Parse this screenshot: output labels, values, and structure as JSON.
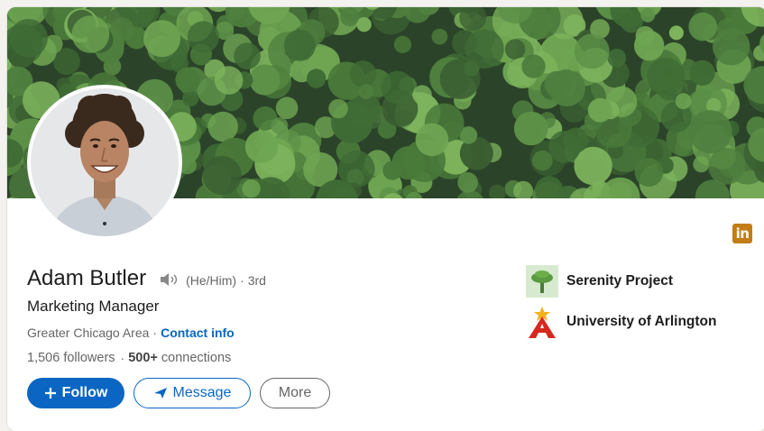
{
  "profile": {
    "name": "Adam Butler",
    "pronouns": "(He/Him)",
    "degree": "3rd",
    "headline": "Marketing Manager",
    "location": "Greater Chicago Area",
    "contact_label": "Contact info",
    "followers": "1,506 followers",
    "connections_count": "500+",
    "connections_label": "connections",
    "name_pronunciation_icon": "speaker-icon"
  },
  "actions": {
    "follow_label": "Follow",
    "message_label": "Message",
    "more_label": "More"
  },
  "orgs": [
    {
      "name": "Serenity Project",
      "logo": "tree-logo"
    },
    {
      "name": "University of Arlington",
      "logo": "letter-a-star-logo"
    }
  ],
  "badge": {
    "label": "in",
    "color": "#c37d16"
  },
  "colors": {
    "accent": "#0a66c2",
    "text": "#1d1d1d",
    "muted": "#666666"
  }
}
